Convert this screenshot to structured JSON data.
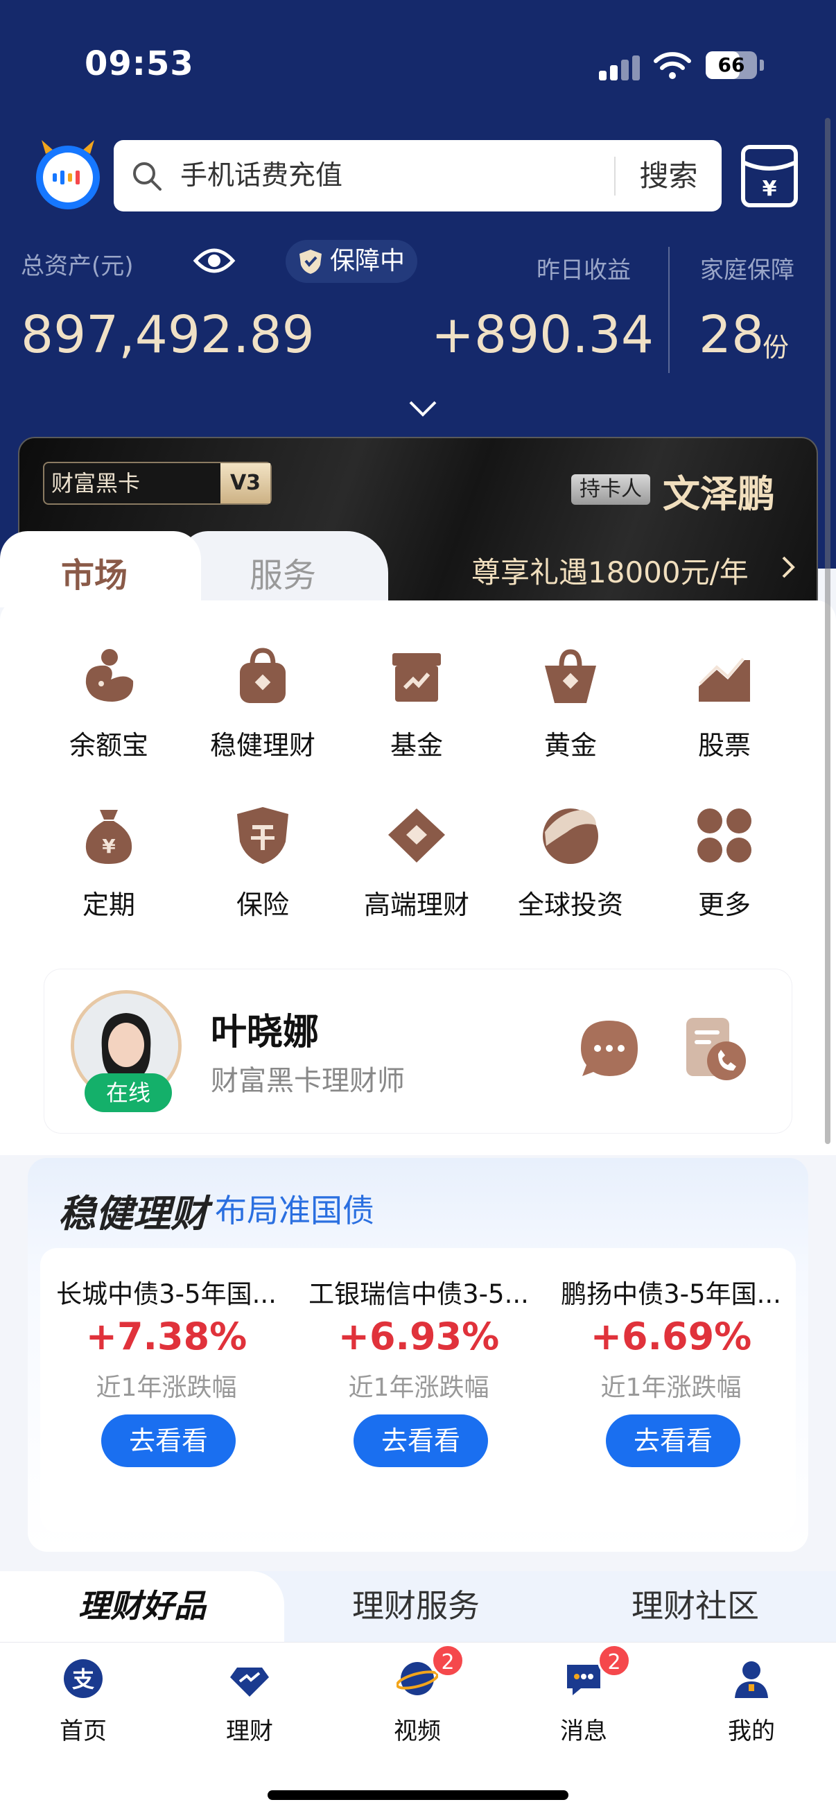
{
  "status_bar": {
    "time": "09:53",
    "battery": "66",
    "battery_level": 0.66
  },
  "search": {
    "placeholder": "手机话费充值",
    "button": "搜索"
  },
  "assets": {
    "total_label": "总资产(元)",
    "guard_label": "保障中",
    "total_value": "897,492.89",
    "yesterday_label": "昨日收益",
    "yesterday_value": "+890.34",
    "family_label": "家庭保障",
    "family_value": "28",
    "family_unit": "份"
  },
  "black_card": {
    "badge": "财富黑卡",
    "level": "V3",
    "holder_label": "持卡人",
    "holder_name": "文泽鹏",
    "offer": "尊享礼遇18000元/年"
  },
  "tabs": {
    "market": "市场",
    "service": "服务"
  },
  "grid": [
    {
      "label": "余额宝",
      "icon": "yuebao-icon"
    },
    {
      "label": "稳健理财",
      "icon": "bag-lock-icon"
    },
    {
      "label": "基金",
      "icon": "fund-box-icon"
    },
    {
      "label": "黄金",
      "icon": "gold-bag-icon"
    },
    {
      "label": "股票",
      "icon": "stock-chart-icon"
    },
    {
      "label": "定期",
      "icon": "money-bag-icon"
    },
    {
      "label": "保险",
      "icon": "insurance-shield-icon"
    },
    {
      "label": "高端理财",
      "icon": "diamond-icon"
    },
    {
      "label": "全球投资",
      "icon": "globe-icon"
    },
    {
      "label": "更多",
      "icon": "more-dots-icon"
    }
  ],
  "advisor": {
    "name": "叶晓娜",
    "title": "财富黑卡理财师",
    "status": "在线"
  },
  "featured": {
    "title": "稳健理财",
    "subtitle": "布局准国债",
    "products": [
      {
        "name": "长城中债3-5年国...",
        "rate": "+7.38%",
        "rate_label": "近1年涨跌幅",
        "button": "去看看"
      },
      {
        "name": "工银瑞信中债3-5...",
        "rate": "+6.93%",
        "rate_label": "近1年涨跌幅",
        "button": "去看看"
      },
      {
        "name": "鹏扬中债3-5年国...",
        "rate": "+6.69%",
        "rate_label": "近1年涨跌幅",
        "button": "去看看"
      }
    ]
  },
  "bottom_tabs": [
    "理财好品",
    "理财服务",
    "理财社区"
  ],
  "nav": [
    {
      "label": "首页",
      "badge": ""
    },
    {
      "label": "理财",
      "badge": ""
    },
    {
      "label": "视频",
      "badge": "2"
    },
    {
      "label": "消息",
      "badge": "2"
    },
    {
      "label": "我的",
      "badge": ""
    }
  ],
  "colors": {
    "header_bg": "#15296b",
    "gold_text": "#f0e1c6",
    "accent_blue": "#1a6ff0",
    "rise_red": "#e0323b",
    "icon_brown": "#8a5a48"
  }
}
